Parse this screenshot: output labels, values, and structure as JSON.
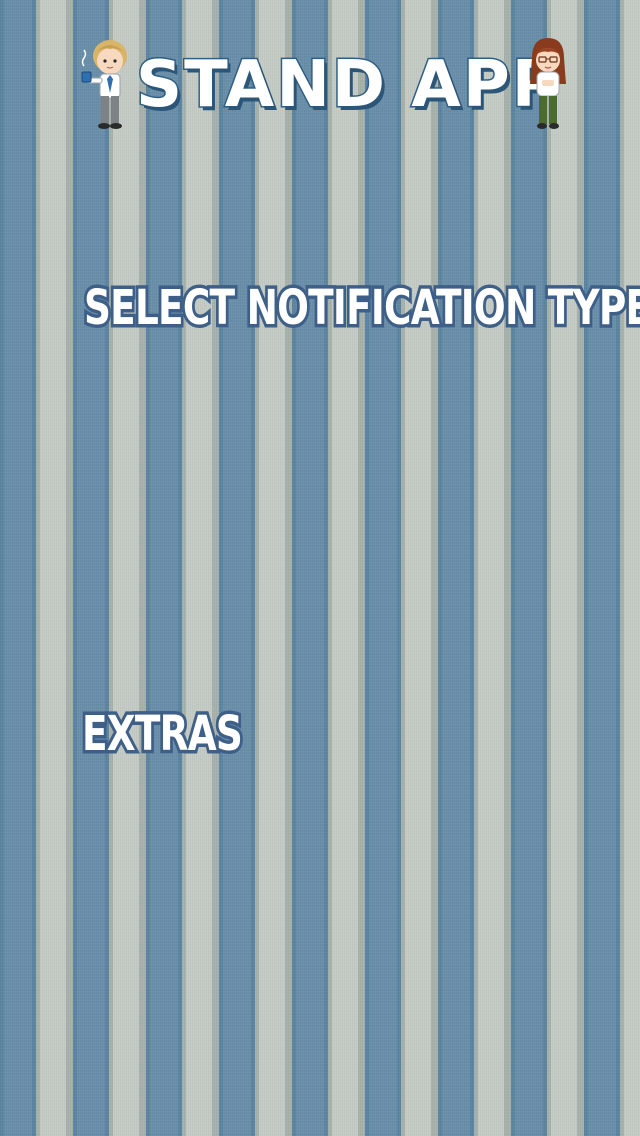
{
  "header": {
    "title": "STAND APP",
    "left_mascot_icon": "businessman-with-coffee-icon",
    "right_mascot_icon": "businesswoman-with-glasses-icon"
  },
  "sections": {
    "notification_heading": "SELECT NOTIFICATION TYPE",
    "extras_heading": "EXTRAS"
  },
  "colors": {
    "stripe_blue": "#6a90ab",
    "stripe_light": "#c6ccc6",
    "heading_outline": "#3e5f88",
    "heading_fill": "#ffffff"
  }
}
